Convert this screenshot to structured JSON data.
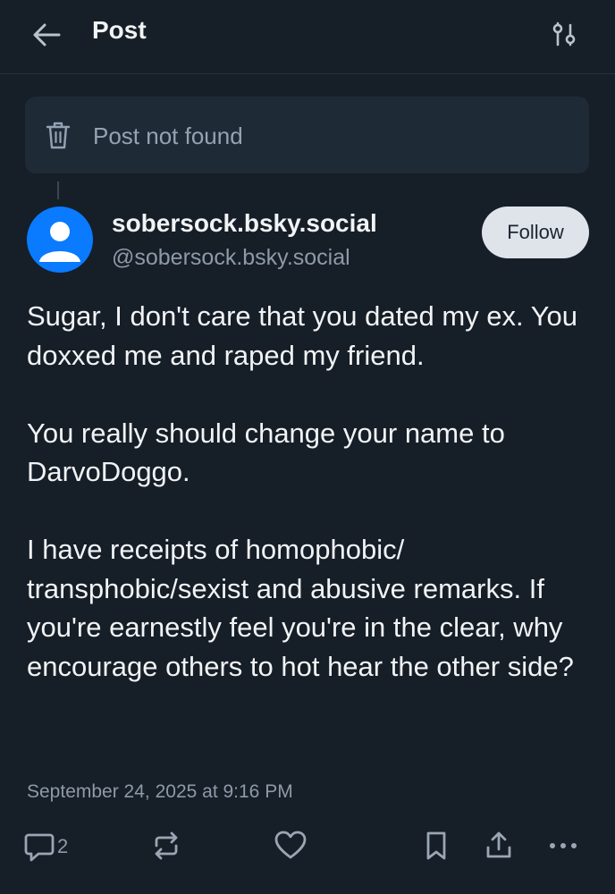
{
  "header": {
    "title": "Post",
    "back_icon": "arrow-left-icon",
    "filter_icon": "sliders-icon"
  },
  "not_found": {
    "label": "Post not found",
    "icon": "trash-icon"
  },
  "author": {
    "display_name": "sobersock.bsky.social",
    "handle": "@sobersock.bsky.social",
    "avatar_color": "#0a7aff",
    "follow_label": "Follow"
  },
  "post": {
    "paragraphs": [
      "Sugar, I don't care that you dated my ex. You doxxed me and raped my friend.",
      "You really should change your name to DarvoDoggo.",
      "I have receipts of homophobic/ transphobic/sexist and abusive remarks. If you're earnestly feel you're in the clear, why encourage others to hot hear the other side?"
    ],
    "timestamp": "September 24, 2025 at 9:16 PM"
  },
  "actions": {
    "reply_count": "2",
    "icons": [
      "reply-icon",
      "repost-icon",
      "like-icon",
      "bookmark-icon",
      "share-icon",
      "more-icon"
    ]
  },
  "colors": {
    "background": "#161e27",
    "card": "#1e2a36",
    "muted_text": "#8d9aa8",
    "accent": "#0a7aff"
  }
}
